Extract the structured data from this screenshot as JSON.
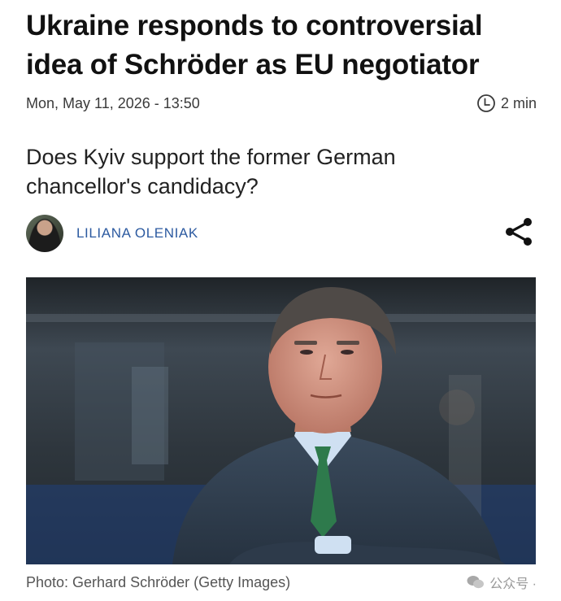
{
  "article": {
    "headline_line1": "Ukraine responds to controversial",
    "headline_line2": "idea of Schröder as EU negotiator",
    "date": "Mon, May 11, 2026 - 13:50",
    "read_time": "2 min",
    "subtitle_line1": "Does Kyiv support the former German",
    "subtitle_line2": "chancellor's candidacy?",
    "author": "LILIANA OLENIAK",
    "photo_caption": "Photo: Gerhard Schröder (Getty Images)"
  },
  "watermark": {
    "text": "公众号 ·"
  },
  "icons": {
    "clock": "clock-icon",
    "share": "share-icon",
    "wechat": "wechat-icon"
  },
  "colors": {
    "author": "#2c5aa0",
    "headline": "#111111",
    "meta": "#3a3a3a"
  }
}
